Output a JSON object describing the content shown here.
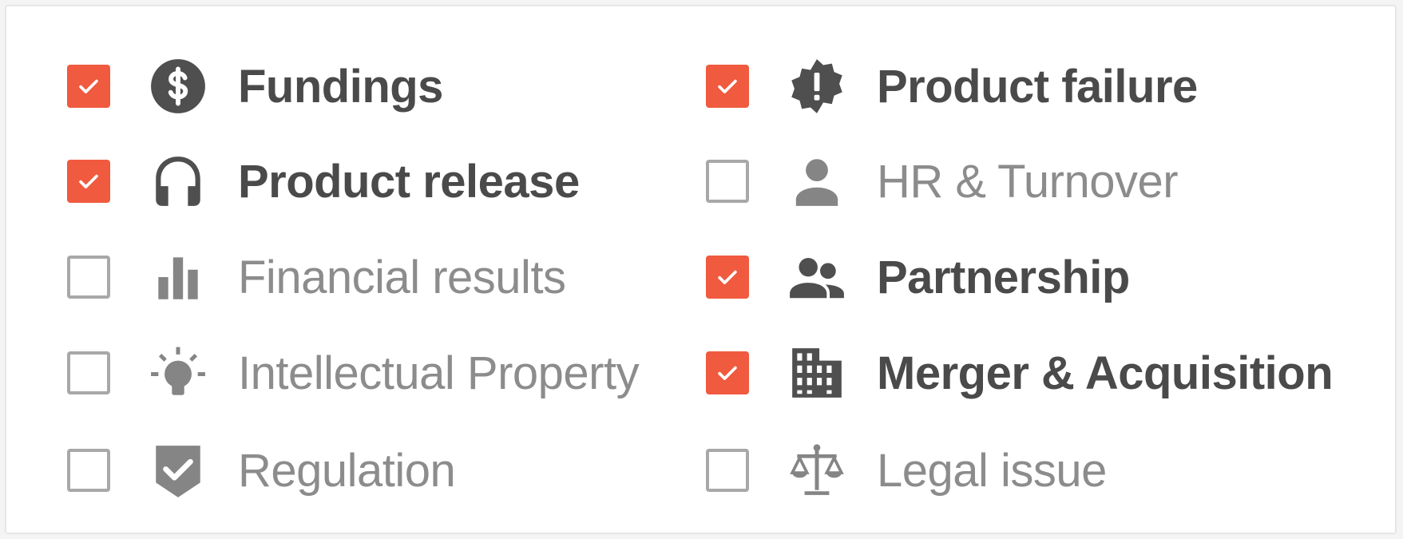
{
  "filters": {
    "left": [
      {
        "label": "Fundings",
        "checked": true,
        "icon": "dollar-circle-icon"
      },
      {
        "label": "Product release",
        "checked": true,
        "icon": "headphones-icon"
      },
      {
        "label": "Financial results",
        "checked": false,
        "icon": "bar-chart-icon"
      },
      {
        "label": "Intellectual Property",
        "checked": false,
        "icon": "lightbulb-icon"
      },
      {
        "label": "Regulation",
        "checked": false,
        "icon": "shield-check-icon"
      }
    ],
    "right": [
      {
        "label": "Product failure",
        "checked": true,
        "icon": "alert-badge-icon"
      },
      {
        "label": "HR & Turnover",
        "checked": false,
        "icon": "person-icon"
      },
      {
        "label": "Partnership",
        "checked": true,
        "icon": "people-icon"
      },
      {
        "label": "Merger & Acquisition",
        "checked": true,
        "icon": "building-icon"
      },
      {
        "label": "Legal issue",
        "checked": false,
        "icon": "scales-icon"
      }
    ]
  },
  "colors": {
    "checked_accent": "#f05a3f",
    "unchecked_border": "#a8a8a8",
    "active_text": "#4a4a4a",
    "inactive_text": "#8c8c8c"
  }
}
